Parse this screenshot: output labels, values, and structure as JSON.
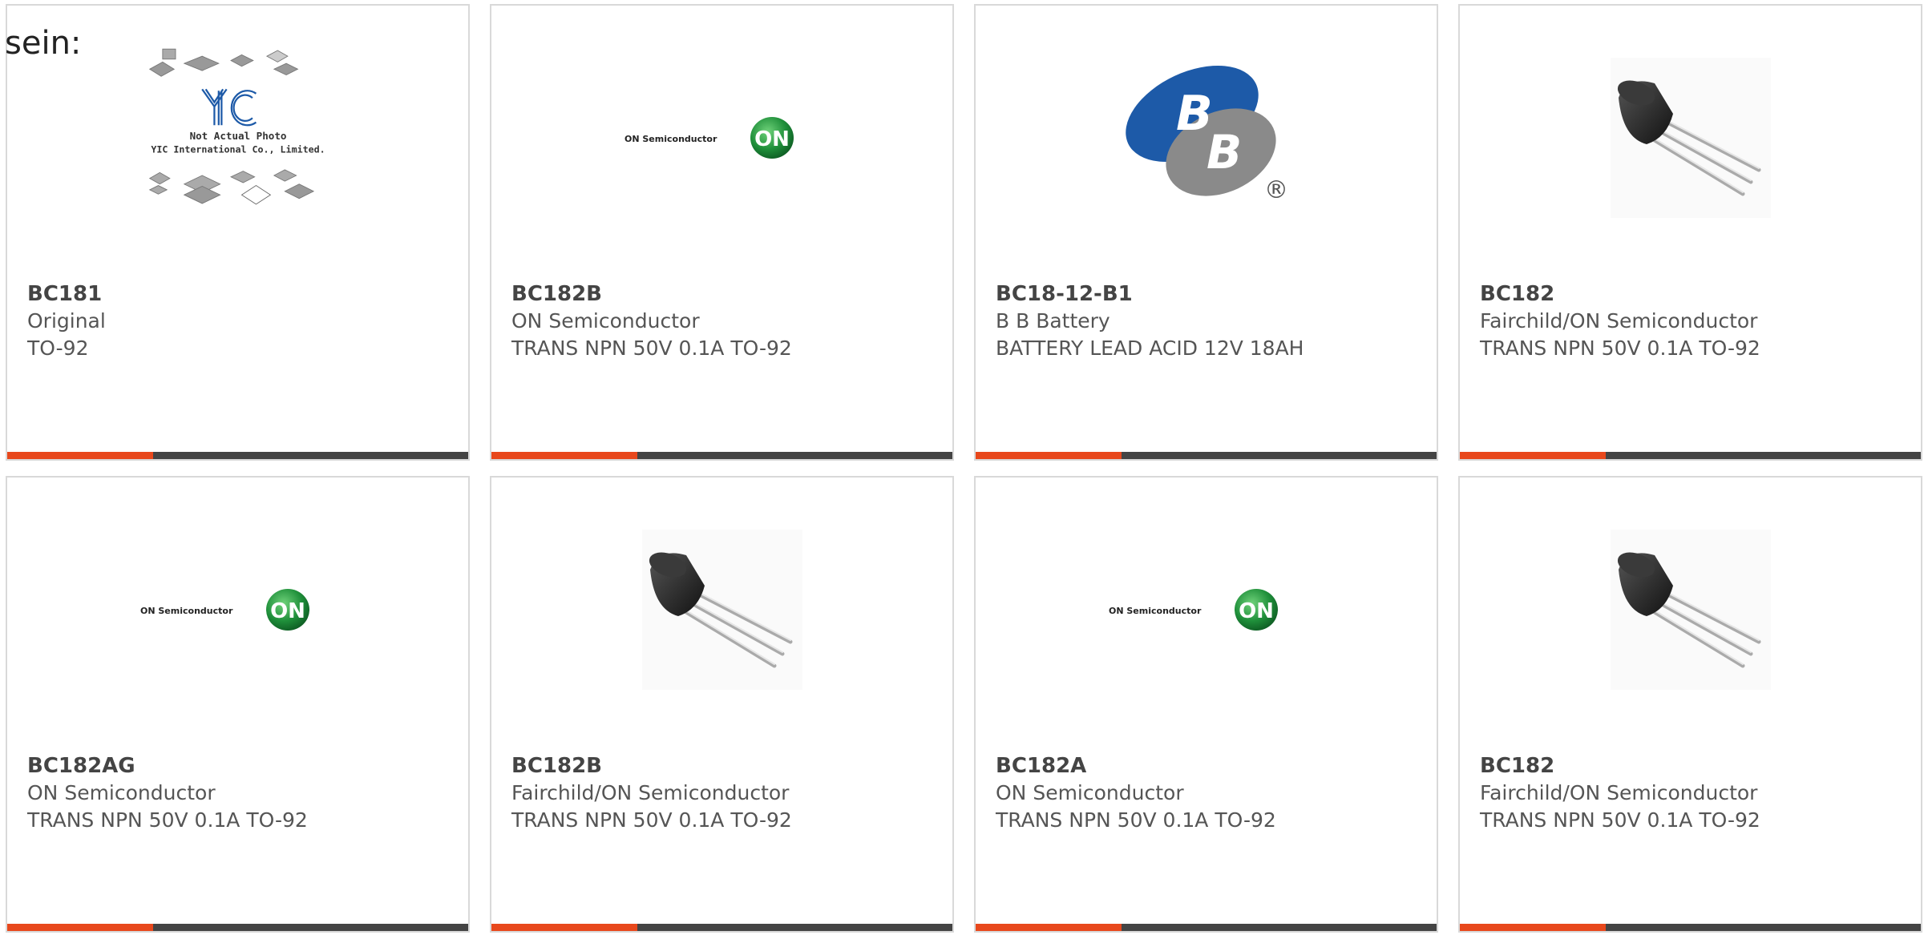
{
  "intro_text": "sein:",
  "colors": {
    "card_border": "#d9d9d9",
    "accent_bar": "#e8481c",
    "dark_bar": "#444444",
    "text": "#555555",
    "on_green": "#1f8f3a",
    "bb_blue": "#1d5aa8",
    "bb_gray": "#8a8a8a"
  },
  "placeholder_image": {
    "line1": "Not Actual Photo",
    "line2": "YIC International Co., Limited.",
    "logo": "YIC"
  },
  "on_logo": {
    "wordmark": "ON Semiconductor",
    "badge": "ON"
  },
  "bb_logo": {
    "letter": "B",
    "registered": "®"
  },
  "products": [
    {
      "part": "BC181",
      "maker": "Original",
      "desc": "TO-92",
      "image": "yic-placeholder"
    },
    {
      "part": "BC182B",
      "maker": "ON Semiconductor",
      "desc": "TRANS NPN 50V 0.1A TO-92",
      "image": "on-semiconductor-logo"
    },
    {
      "part": "BC18-12-B1",
      "maker": "B B Battery",
      "desc": "BATTERY LEAD ACID 12V 18AH",
      "image": "bb-battery-logo"
    },
    {
      "part": "BC182",
      "maker": "Fairchild/ON Semiconductor",
      "desc": "TRANS NPN 50V 0.1A TO-92",
      "image": "to92-transistor"
    },
    {
      "part": "BC182AG",
      "maker": "ON Semiconductor",
      "desc": "TRANS NPN 50V 0.1A TO-92",
      "image": "on-semiconductor-logo"
    },
    {
      "part": "BC182B",
      "maker": "Fairchild/ON Semiconductor",
      "desc": "TRANS NPN 50V 0.1A TO-92",
      "image": "to92-transistor"
    },
    {
      "part": "BC182A",
      "maker": "ON Semiconductor",
      "desc": "TRANS NPN 50V 0.1A TO-92",
      "image": "on-semiconductor-logo"
    },
    {
      "part": "BC182",
      "maker": "Fairchild/ON Semiconductor",
      "desc": "TRANS NPN 50V 0.1A TO-92",
      "image": "to92-transistor"
    }
  ]
}
